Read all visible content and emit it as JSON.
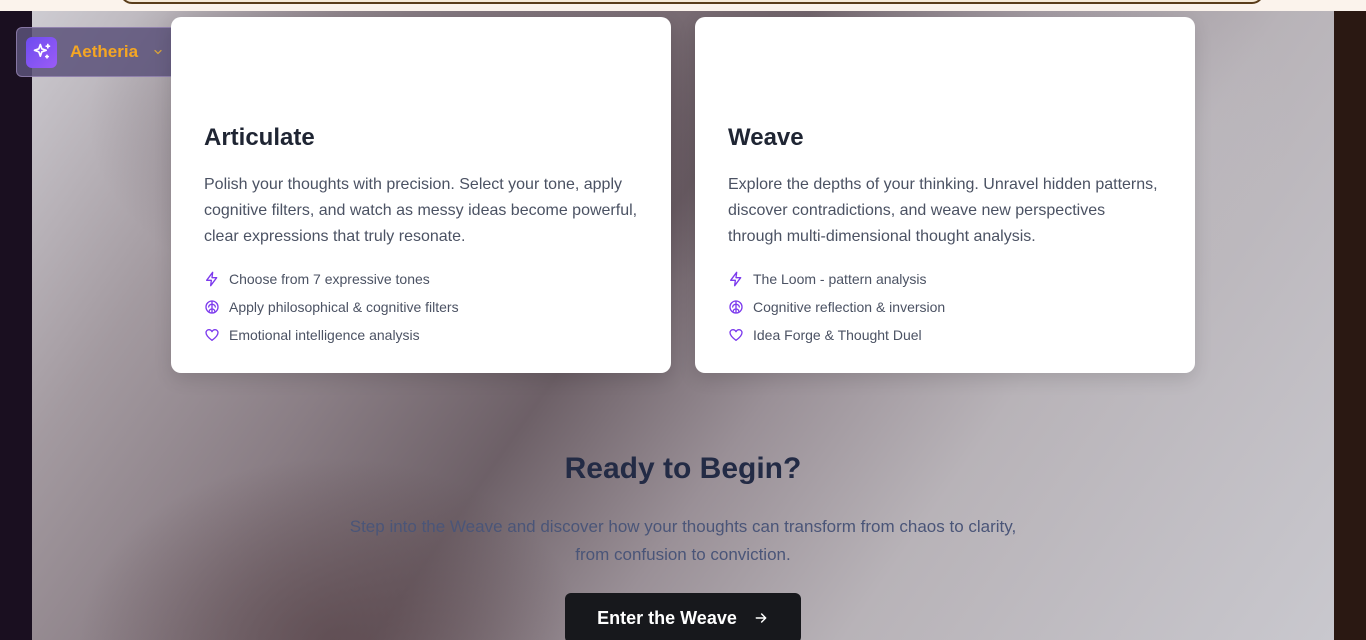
{
  "brand": {
    "name": "Aetheria",
    "logo_icon": "sparkles-icon",
    "menu_icon": "chevron-down-icon"
  },
  "cards": [
    {
      "title": "Articulate",
      "description": "Polish your thoughts with precision. Select your tone, apply cognitive filters, and watch as messy ideas become powerful, clear expressions that truly resonate.",
      "features": [
        {
          "icon": "lightning-icon",
          "label": "Choose from 7 expressive tones"
        },
        {
          "icon": "brain-icon",
          "label": "Apply philosophical & cognitive filters"
        },
        {
          "icon": "heart-icon",
          "label": "Emotional intelligence analysis"
        }
      ]
    },
    {
      "title": "Weave",
      "description": "Explore the depths of your thinking. Unravel hidden patterns, discover contradictions, and weave new perspectives through multi-dimensional thought analysis.",
      "features": [
        {
          "icon": "lightning-icon",
          "label": "The Loom - pattern analysis"
        },
        {
          "icon": "brain-icon",
          "label": "Cognitive reflection & inversion"
        },
        {
          "icon": "heart-icon",
          "label": "Idea Forge & Thought Duel"
        }
      ]
    }
  ],
  "cta": {
    "title": "Ready to Begin?",
    "subtitle": "Step into the Weave and discover how your thoughts can transform from chaos to clarity, from confusion to conviction.",
    "button_label": "Enter the Weave",
    "button_icon": "arrow-right-icon"
  },
  "colors": {
    "accent": "#7c3aed",
    "brand_text": "#f5a623",
    "button_bg": "#17181c"
  }
}
